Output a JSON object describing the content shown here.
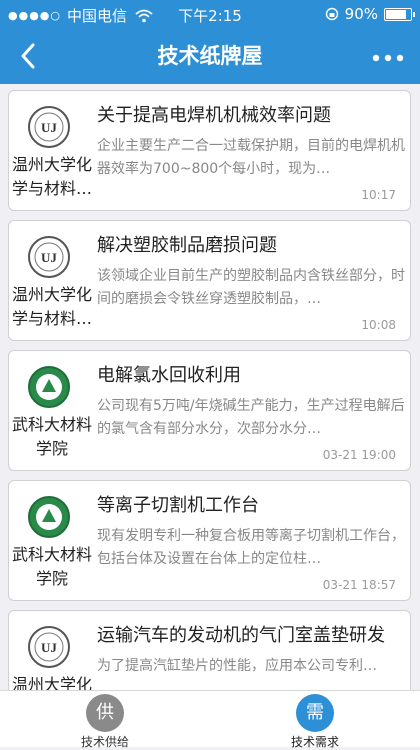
{
  "status": {
    "carrier": "中国电信",
    "time": "下午2:15",
    "battery": "90%",
    "battery_level": 0.9
  },
  "nav": {
    "title": "技术纸牌屋"
  },
  "cards": [
    {
      "logo": "wzu",
      "org": "温州大学化学与材料…",
      "title": "关于提高电焊机机械效率问题",
      "desc": "企业主要生产二合一过载保护期，目前的电焊机机器效率为700~800个每小时，现为…",
      "time": "10:17"
    },
    {
      "logo": "wzu",
      "org": "温州大学化学与材料…",
      "title": "解决塑胶制品磨损问题",
      "desc": "该领域企业目前生产的塑胶制品内含铁丝部分，时间的磨损会令铁丝穿透塑胶制品，…",
      "time": "10:08"
    },
    {
      "logo": "wust",
      "org": "武科大材料学院",
      "title": "电解氯水回收利用",
      "desc": "公司现有5万吨/年烧碱生产能力，生产过程电解后的氯气含有部分水分，次部分水分…",
      "time": "03-21 19:00"
    },
    {
      "logo": "wust",
      "org": "武科大材料学院",
      "title": "等离子切割机工作台",
      "desc": "现有发明专利一种复合板用等离子切割机工作台，包括台体及设置在台体上的定位柱…",
      "time": "03-21 18:57"
    },
    {
      "logo": "wzu",
      "org": "温州大学化学与材料…",
      "title": "运输汽车的发动机的气门室盖垫研发",
      "desc": "为了提高汽缸垫片的性能，应用本公司专利…",
      "time": ""
    }
  ],
  "tabs": [
    {
      "icon_text": "供",
      "label": "技术供给",
      "active": false,
      "color": "#8a8a8a"
    },
    {
      "icon_text": "需",
      "label": "技术需求",
      "active": true,
      "color": "#2d8fd6"
    }
  ],
  "colors": {
    "accent": "#2d8fd6"
  }
}
